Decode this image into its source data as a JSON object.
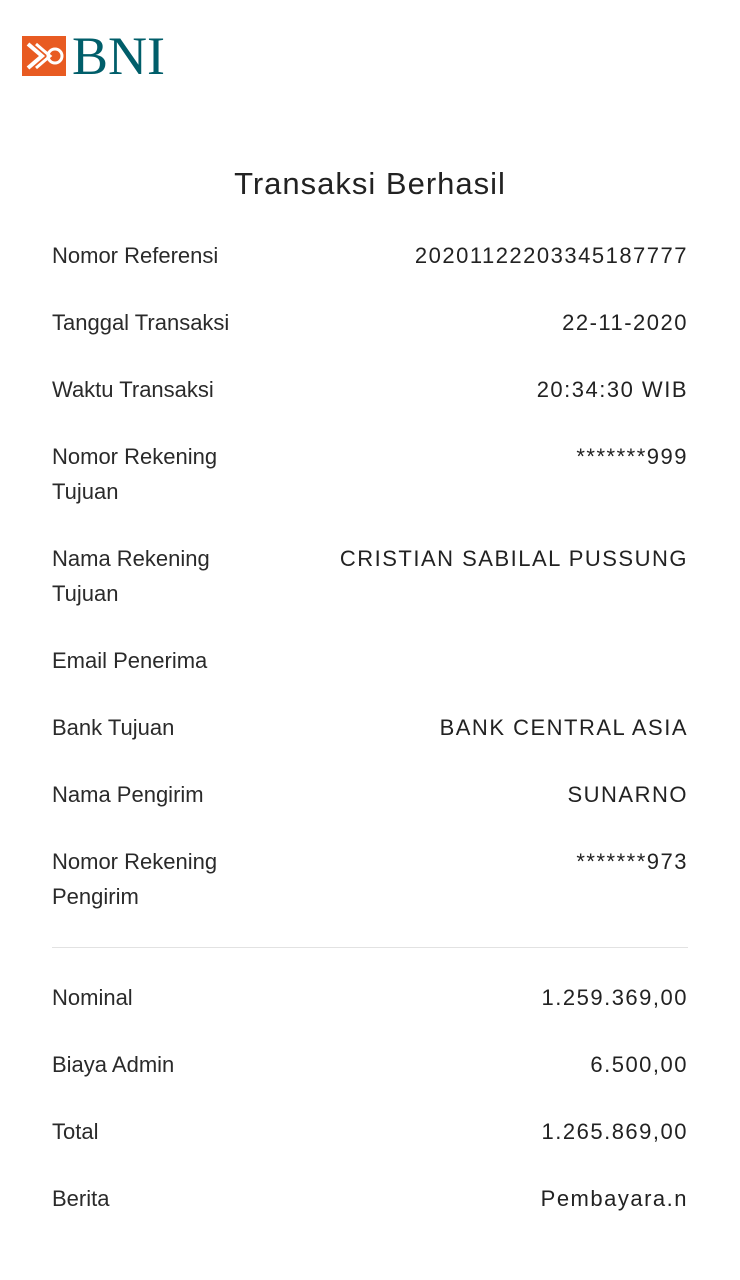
{
  "brand": {
    "name": "BNI",
    "mark_color": "#e85b22",
    "text_color": "#005e6a"
  },
  "title": "Transaksi Berhasil",
  "details": [
    {
      "label": "Nomor Referensi",
      "value": "20201122203345187777"
    },
    {
      "label": "Tanggal Transaksi",
      "value": "22-11-2020"
    },
    {
      "label": "Waktu Transaksi",
      "value": "20:34:30 WIB"
    },
    {
      "label": "Nomor Rekening Tujuan",
      "value": "*******999"
    },
    {
      "label": "Nama Rekening Tujuan",
      "value": "CRISTIAN SABILAL PUSSUNG"
    },
    {
      "label": "Email Penerima",
      "value": ""
    },
    {
      "label": "Bank Tujuan",
      "value": "BANK CENTRAL ASIA"
    },
    {
      "label": "Nama Pengirim",
      "value": "SUNARNO"
    },
    {
      "label": "Nomor Rekening Pengirim",
      "value": "*******973"
    }
  ],
  "amounts": [
    {
      "label": "Nominal",
      "value": "1.259.369,00"
    },
    {
      "label": "Biaya Admin",
      "value": "6.500,00"
    },
    {
      "label": "Total",
      "value": "1.265.869,00"
    },
    {
      "label": "Berita",
      "value": "Pembayara.n"
    }
  ]
}
